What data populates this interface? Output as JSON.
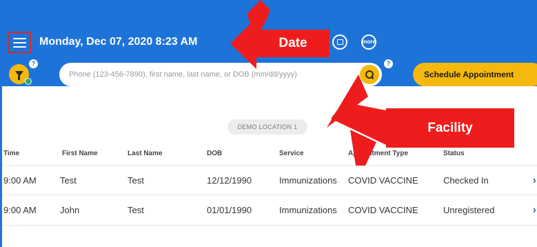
{
  "header": {
    "date_time": "Monday, Dec 07, 2020 8:23 AM",
    "more_icon_label": "more",
    "help_mark": "?"
  },
  "search": {
    "placeholder": "Phone (123-456-7890), first name, last name, or DOB (mm/dd/yyyy)",
    "value": ""
  },
  "actions": {
    "schedule_label": "Schedule Appointment"
  },
  "facility": {
    "location_name": "DEMO LOCATION 1"
  },
  "table": {
    "columns": [
      "Time",
      "First Name",
      "Last Name",
      "DOB",
      "Service",
      "Appointment Type",
      "Status"
    ],
    "rows": [
      {
        "time": "9:00 AM",
        "first_name": "Test",
        "last_name": "Test",
        "dob": "12/12/1990",
        "service": "Immunizations",
        "appointment_type": "COVID VACCINE",
        "status": "Checked In"
      },
      {
        "time": "9:00 AM",
        "first_name": "John",
        "last_name": "Test",
        "dob": "01/01/1990",
        "service": "Immunizations",
        "appointment_type": "COVID VACCINE",
        "status": "Unregistered"
      }
    ],
    "row_chevron": "›"
  },
  "annotations": {
    "date_label": "Date",
    "facility_label": "Facility",
    "color": "#ee1c1c"
  },
  "colors": {
    "primary_blue": "#1e73d8",
    "accent_yellow": "#f5b90d",
    "highlight_red": "#d62a2a",
    "check_green": "#2aa772"
  },
  "icons": {
    "menu": "hamburger-menu-icon",
    "calendar": "calendar-icon",
    "more": "more-icon",
    "filter": "filter-icon",
    "search": "search-icon",
    "row_open": "chevron-right-icon"
  }
}
